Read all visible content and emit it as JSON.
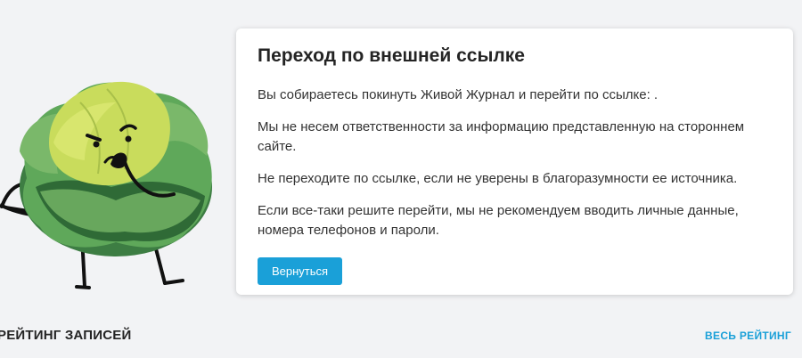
{
  "dialog": {
    "title": "Переход по внешней ссылке",
    "paragraphs": [
      "Вы собираетесь покинуть Живой Журнал и перейти по ссылке: .",
      "Мы не несем ответственности за информацию представленную на стороннем сайте.",
      "Не переходите по ссылке, если не уверены в благоразумности ее источника.",
      "Если все-таки решите перейти, мы не рекомендуем вводить личные данные, номера телефонов и пароли."
    ],
    "back_button_label": "Вернуться"
  },
  "rating": {
    "title": "РЕЙТИНГ ЗАПИСЕЙ",
    "all_link_label": "ВЕСЬ РЕЙТИНГ"
  },
  "mascot": {
    "icon": "cabbage-mascot-icon"
  },
  "colors": {
    "accent": "#1aa0d8",
    "background": "#f2f3f5",
    "card": "#ffffff"
  }
}
